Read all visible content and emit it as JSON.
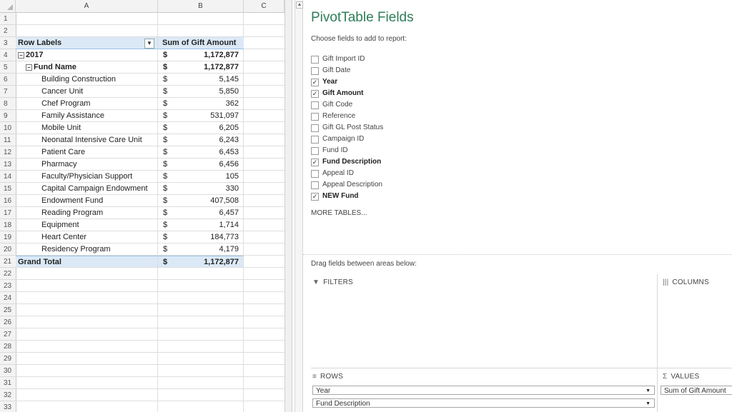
{
  "sheet": {
    "columns": [
      "A",
      "B",
      "C"
    ],
    "header": {
      "row_labels": "Row Labels",
      "sum_label": "Sum of Gift Amount",
      "filter_icon": "filter-icon"
    },
    "rows": [
      {
        "n": "1"
      },
      {
        "n": "2"
      },
      {
        "n": "3"
      },
      {
        "n": "4",
        "label": "2017",
        "currency": "$",
        "value": "1,172,877"
      },
      {
        "n": "5",
        "label": "Fund Name",
        "currency": "$",
        "value": "1,172,877"
      },
      {
        "n": "6",
        "label": "Building Construction",
        "currency": "$",
        "value": "5,145"
      },
      {
        "n": "7",
        "label": "Cancer Unit",
        "currency": "$",
        "value": "5,850"
      },
      {
        "n": "8",
        "label": "Chef Program",
        "currency": "$",
        "value": "362"
      },
      {
        "n": "9",
        "label": "Family Assistance",
        "currency": "$",
        "value": "531,097"
      },
      {
        "n": "10",
        "label": "Mobile Unit",
        "currency": "$",
        "value": "6,205"
      },
      {
        "n": "11",
        "label": "Neonatal Intensive Care Unit",
        "currency": "$",
        "value": "6,243"
      },
      {
        "n": "12",
        "label": "Patient Care",
        "currency": "$",
        "value": "6,453"
      },
      {
        "n": "13",
        "label": "Pharmacy",
        "currency": "$",
        "value": "6,456"
      },
      {
        "n": "14",
        "label": "Faculty/Physician Support",
        "currency": "$",
        "value": "105"
      },
      {
        "n": "15",
        "label": "Capital Campaign Endowment",
        "currency": "$",
        "value": "330"
      },
      {
        "n": "16",
        "label": "Endowment Fund",
        "currency": "$",
        "value": "407,508"
      },
      {
        "n": "17",
        "label": "Reading Program",
        "currency": "$",
        "value": "6,457"
      },
      {
        "n": "18",
        "label": "Equipment",
        "currency": "$",
        "value": "1,714"
      },
      {
        "n": "19",
        "label": "Heart Center",
        "currency": "$",
        "value": "184,773"
      },
      {
        "n": "20",
        "label": "Residency Program",
        "currency": "$",
        "value": "4,179"
      },
      {
        "n": "21",
        "label": "Grand Total",
        "currency": "$",
        "value": "1,172,877"
      },
      {
        "n": "22"
      },
      {
        "n": "23"
      },
      {
        "n": "24"
      },
      {
        "n": "25"
      },
      {
        "n": "26"
      },
      {
        "n": "27"
      },
      {
        "n": "28"
      },
      {
        "n": "29"
      },
      {
        "n": "30"
      },
      {
        "n": "31"
      },
      {
        "n": "32"
      },
      {
        "n": "33"
      }
    ],
    "toggle_symbol": "⊟"
  },
  "pivot": {
    "title": "PivotTable Fields",
    "subtitle": "Choose fields to add to report:",
    "fields": [
      {
        "label": "Gift Import ID",
        "checked": false
      },
      {
        "label": "Gift Date",
        "checked": false
      },
      {
        "label": "Year",
        "checked": true
      },
      {
        "label": "Gift Amount",
        "checked": true
      },
      {
        "label": "Gift Code",
        "checked": false
      },
      {
        "label": "Reference",
        "checked": false
      },
      {
        "label": "Gift GL Post Status",
        "checked": false
      },
      {
        "label": "Campaign ID",
        "checked": false
      },
      {
        "label": "Fund ID",
        "checked": false
      },
      {
        "label": "Fund Description",
        "checked": true
      },
      {
        "label": "Appeal ID",
        "checked": false
      },
      {
        "label": "Appeal Description",
        "checked": false
      },
      {
        "label": "NEW Fund",
        "checked": true
      }
    ],
    "more_tables": "MORE TABLES...",
    "drag_hint": "Drag fields between areas below:",
    "areas": {
      "filters": "FILTERS",
      "columns": "COLUMNS",
      "rows": "ROWS",
      "values": "VALUES",
      "rows_fields": [
        "Year",
        "Fund Description"
      ],
      "values_fields": [
        "Sum of Gift Amount"
      ]
    },
    "icons": {
      "filters": "filter-icon",
      "columns": "columns-icon",
      "rows": "rows-icon",
      "values": "sigma-icon"
    },
    "accent_color": "#2e7d58"
  }
}
